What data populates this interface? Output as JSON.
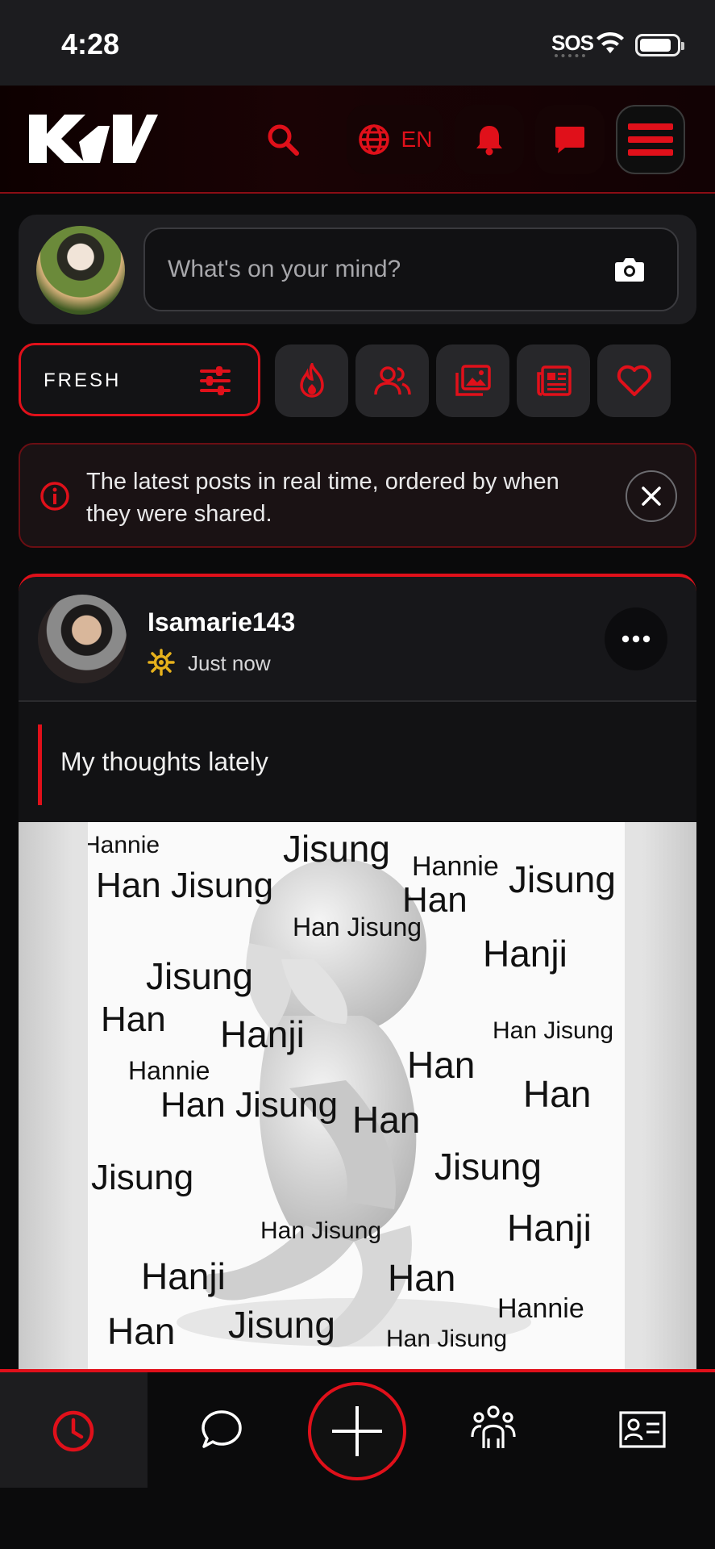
{
  "status_bar": {
    "time": "4:28",
    "sos": "SOS"
  },
  "header": {
    "logo": "KV",
    "language": "EN",
    "icons": [
      "search-icon",
      "globe-icon",
      "bell-icon",
      "chat-icon",
      "menu-icon"
    ]
  },
  "composer": {
    "placeholder": "What's on your mind?"
  },
  "filters": {
    "active_label": "FRESH",
    "tabs": [
      "fire-icon",
      "people-icon",
      "gallery-icon",
      "news-icon",
      "heart-icon"
    ]
  },
  "info_banner": {
    "text": "The latest posts in real time, ordered by when they were shared."
  },
  "post": {
    "username": "Isamarie143",
    "time": "Just now",
    "text": "My thoughts lately",
    "image_words": [
      "Hannie",
      "Jisung",
      "Hannie",
      "Han Jisung",
      "Han",
      "Jisung",
      "Han Jisung",
      "Hanji",
      "Jisung",
      "Han",
      "Hanji",
      "Han Jisung",
      "Hannie",
      "Han",
      "Han",
      "Han Jisung",
      "Han",
      "Jisung",
      "Jisung",
      "Hanji",
      "Han Jisung",
      "Hanji",
      "Han",
      "Hannie",
      "Han",
      "Jisung",
      "Han Jisung"
    ]
  },
  "bottom_nav": {
    "items": [
      "clock-icon",
      "message-icon",
      "add-icon",
      "community-icon",
      "profile-card-icon"
    ]
  },
  "colors": {
    "accent": "#e0101a",
    "background": "#0a0a0b",
    "card": "#17171a"
  }
}
